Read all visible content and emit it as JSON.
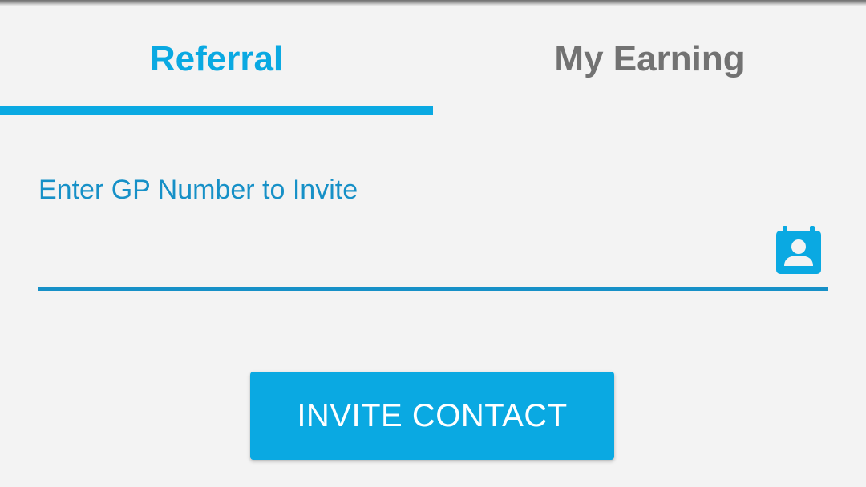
{
  "tabs": [
    {
      "label": "Referral",
      "active": true
    },
    {
      "label": "My Earning",
      "active": false
    }
  ],
  "invite_form": {
    "label": "Enter GP Number to Invite",
    "phone_value": "",
    "contact_picker_icon": "contact-book-icon",
    "button_label": "INVITE CONTACT"
  },
  "colors": {
    "accent": "#0aa9e2",
    "field_accent": "#1690c7",
    "inactive_tab_text": "#727272",
    "background": "#f3f3f3"
  }
}
